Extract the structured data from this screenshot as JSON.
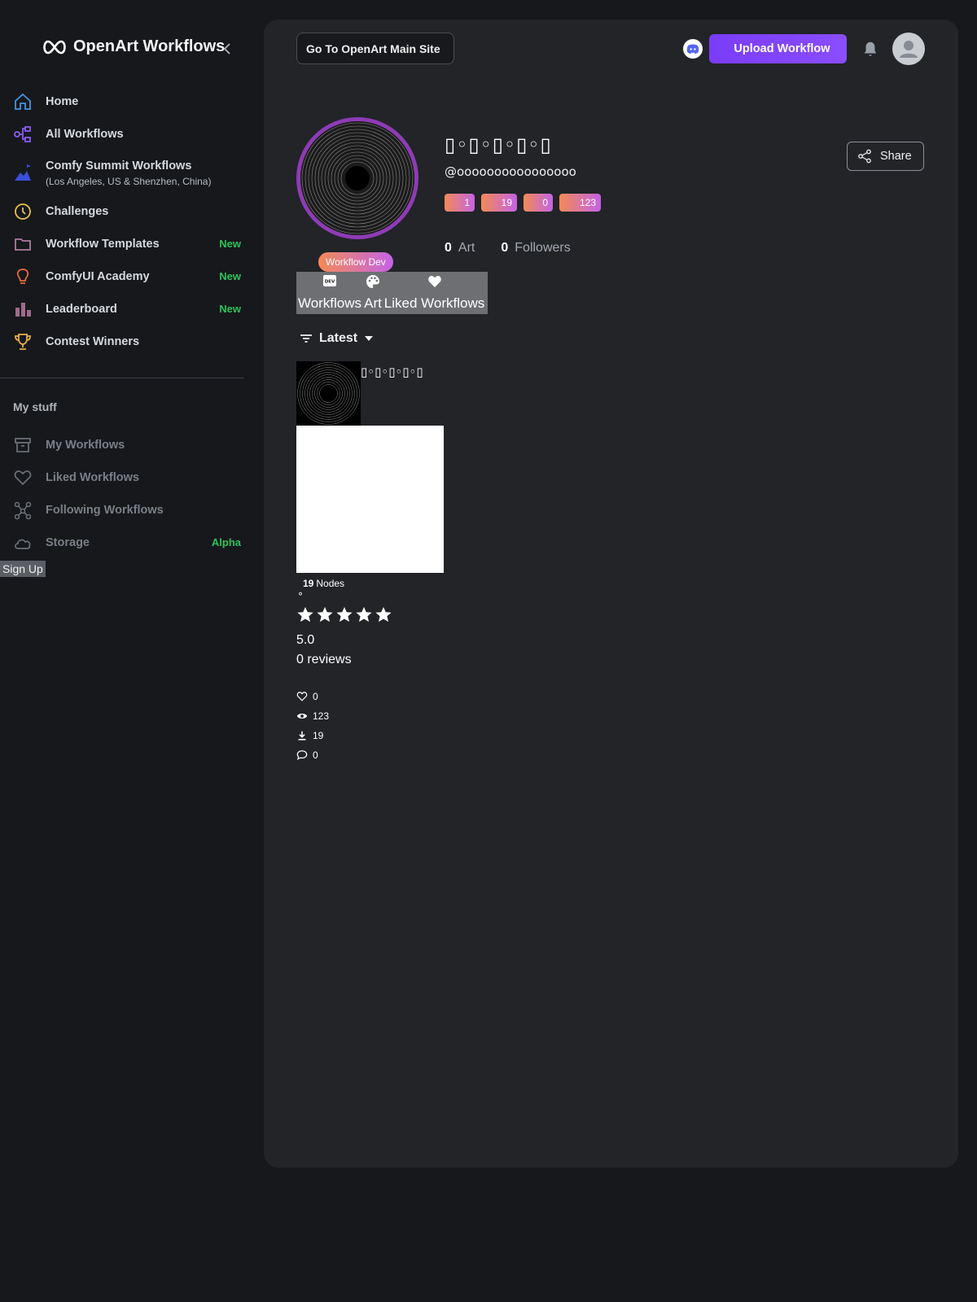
{
  "sidebar": {
    "brand": "OpenArt Workflows",
    "nav": [
      {
        "label": "Home",
        "icon": "home-icon",
        "color": "#4a90e2"
      },
      {
        "label": "All Workflows",
        "icon": "workflow-icon",
        "color": "#8a5cf6"
      },
      {
        "label": "Comfy Summit Workflows",
        "sub": "(Los Angeles, US & Shenzhen, China)",
        "icon": "mountain-flag-icon",
        "color": "#3b4fd8"
      },
      {
        "label": "Challenges",
        "icon": "clock-icon",
        "color": "#e8c14a"
      },
      {
        "label": "Workflow Templates",
        "icon": "folder-icon",
        "badge": "New",
        "color": "#b07aa0"
      },
      {
        "label": "ComfyUI Academy",
        "icon": "lightbulb-icon",
        "badge": "New",
        "color": "#e8693a"
      },
      {
        "label": "Leaderboard",
        "icon": "bar-chart-icon",
        "badge": "New",
        "color": "#a06a8c"
      },
      {
        "label": "Contest Winners",
        "icon": "trophy-icon",
        "color": "#e8b04a"
      }
    ],
    "my_stuff_title": "My stuff",
    "my_stuff": [
      {
        "label": "My Workflows",
        "icon": "archive-icon"
      },
      {
        "label": "Liked Workflows",
        "icon": "heart-icon"
      },
      {
        "label": "Following Workflows",
        "icon": "network-icon"
      },
      {
        "label": "Storage",
        "icon": "cloud-icon",
        "badge": "Alpha"
      }
    ],
    "signup": "Sign Up"
  },
  "header": {
    "main_site": "Go To OpenArt Main Site",
    "upload": "Upload Workflow"
  },
  "profile": {
    "name": "▯◦▯◦▯◦▯◦▯",
    "handle": "@oooooooooooooooo",
    "badge": "Workflow Dev",
    "pills": [
      "1",
      "19",
      "0",
      "123"
    ],
    "art_count": "0",
    "art_label": "Art",
    "followers_count": "0",
    "followers_label": "Followers",
    "share": "Share"
  },
  "tabs": [
    {
      "label": "Workflows",
      "icon": "dev-icon"
    },
    {
      "label": "Art",
      "icon": "palette-icon"
    },
    {
      "label": "Liked Workflows",
      "icon": "heart-icon"
    }
  ],
  "sort": {
    "label": "Latest"
  },
  "card": {
    "title": "▯◦▯◦▯◦▯◦▯",
    "nodes_count": "19",
    "nodes_label": "Nodes",
    "degree": "°",
    "rating": "5.0",
    "reviews": "0 reviews",
    "likes": "0",
    "views": "123",
    "downloads": "19",
    "comments": "0"
  },
  "colors": {
    "accent": "#7a3cf7",
    "badge_green": "#2fc25b",
    "avatar_ring": "#8e3bb5"
  }
}
